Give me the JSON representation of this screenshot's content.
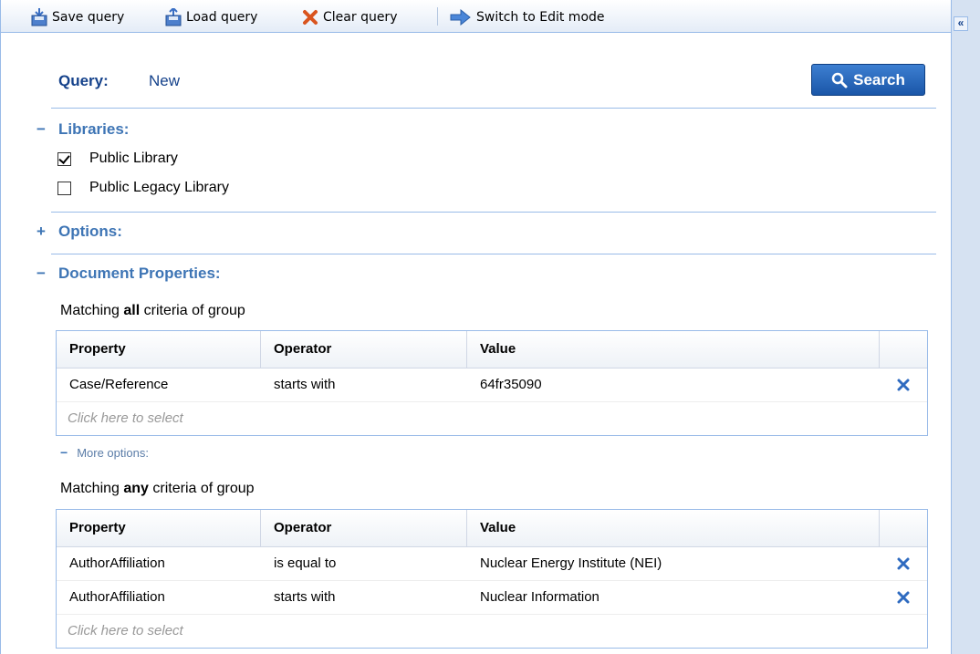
{
  "toolbar": {
    "save_label": "Save query",
    "load_label": "Load query",
    "clear_label": "Clear query",
    "switch_label": "Switch to Edit mode"
  },
  "rail": {
    "collapse_glyph": "«"
  },
  "query": {
    "label": "Query:",
    "value": "New"
  },
  "search_button": {
    "label": "Search"
  },
  "sections": {
    "libraries": {
      "sign": "−",
      "title": "Libraries:"
    },
    "options": {
      "sign": "+",
      "title": "Options:"
    },
    "doc_props": {
      "sign": "−",
      "title": "Document Properties:"
    }
  },
  "libraries": [
    {
      "label": "Public Library",
      "checked": true
    },
    {
      "label": "Public Legacy Library",
      "checked": false
    }
  ],
  "group1": {
    "caption_pre": "Matching ",
    "caption_bold": "all",
    "caption_post": " criteria of group",
    "columns": [
      "Property",
      "Operator",
      "Value"
    ],
    "rows": [
      {
        "property": "Case/Reference",
        "operator": "starts with",
        "value": "64fr35090"
      }
    ],
    "select_placeholder": "Click here to select"
  },
  "more_options": {
    "sign": "−",
    "label": "More options:"
  },
  "group2": {
    "caption_pre": "Matching ",
    "caption_bold": "any",
    "caption_post": " criteria of group",
    "columns": [
      "Property",
      "Operator",
      "Value"
    ],
    "rows": [
      {
        "property": "AuthorAffiliation",
        "operator": "is equal to",
        "value": "Nuclear Energy Institute (NEI)"
      },
      {
        "property": "AuthorAffiliation",
        "operator": "starts with",
        "value": "Nuclear Information"
      }
    ],
    "select_placeholder": "Click here to select"
  },
  "colors": {
    "accent": "#3e75b5",
    "border": "#99bbe8",
    "delete": "#2f6bc0"
  }
}
